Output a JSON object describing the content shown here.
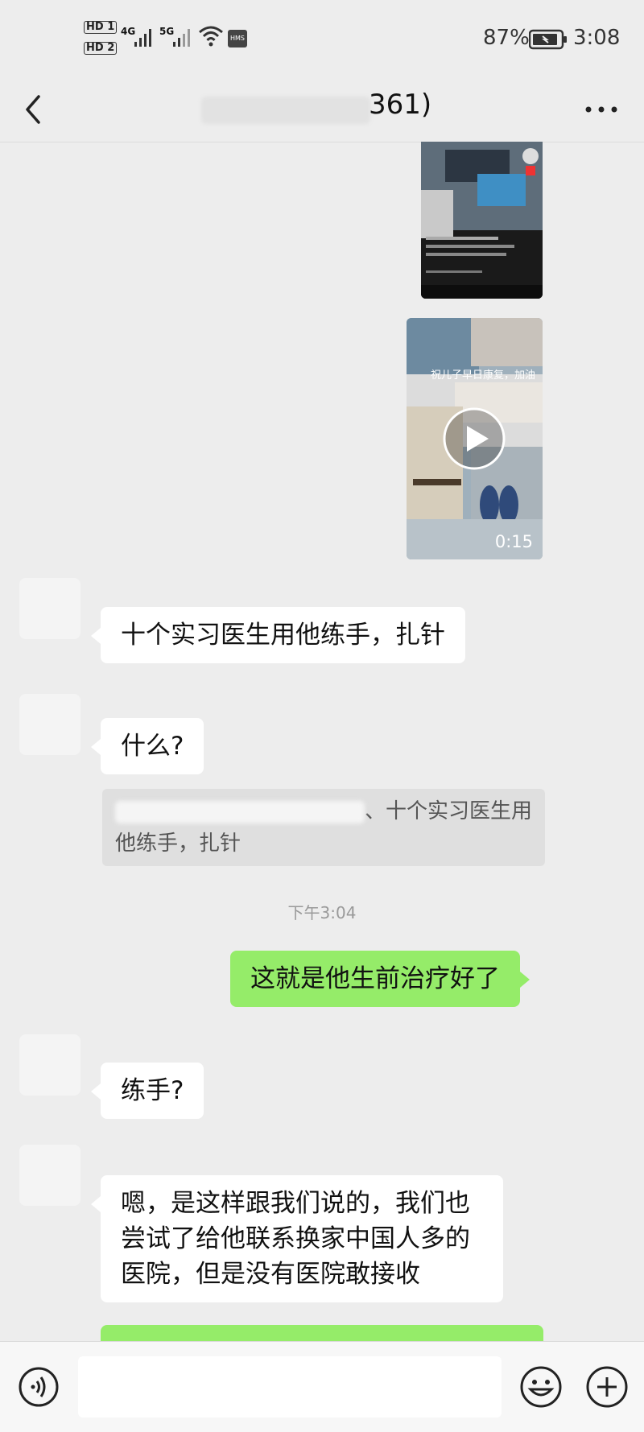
{
  "status_bar": {
    "sim1": "HD 1",
    "sim2": "HD 2",
    "net1": "4G",
    "net2": "5G",
    "hms": "HMS",
    "battery": "87%",
    "time": "3:08"
  },
  "nav": {
    "title_visible": "361)"
  },
  "messages": {
    "video_duration": "0:15",
    "video_caption": "祝儿子早日康复，加油",
    "msg1": "十个实习医生用他练手，扎针",
    "msg2": "什么?",
    "quote_text": "、十个实习医生用他练手，扎针",
    "timestamp": "下午3:04",
    "msg3": "这就是他生前治疗好了",
    "msg4": "练手?",
    "msg5": "嗯，是这样跟我们说的，我们也尝试了给他联系换家中国人多的医院，但是没有医院敢接收"
  },
  "colors": {
    "background": "#ededed",
    "self_bubble": "#95ec69",
    "other_bubble": "#ffffff"
  }
}
